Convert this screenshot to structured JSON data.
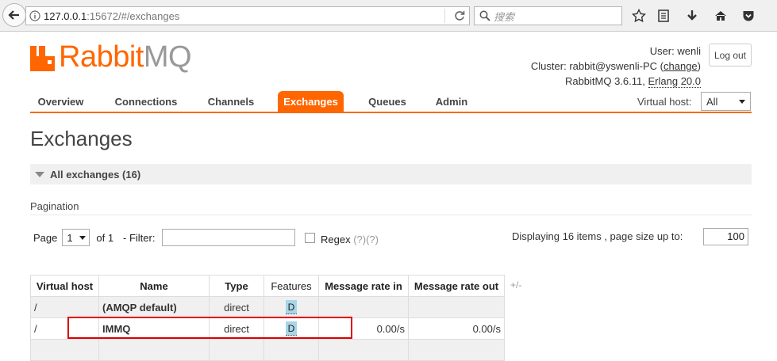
{
  "browser": {
    "url_host": "127.0.0.1",
    "url_rest": ":15672/#/exchanges",
    "search_placeholder": "搜索"
  },
  "logo": {
    "part1": "Rabbit",
    "part2": "MQ"
  },
  "header": {
    "user_label": "User:",
    "user_name": "wenli",
    "cluster_label": "Cluster:",
    "cluster_name": "rabbit@yswenli-PC",
    "cluster_change": "change",
    "version": "RabbitMQ 3.6.11,",
    "erlang": "Erlang 20.0",
    "logout": "Log out"
  },
  "nav": {
    "items": [
      "Overview",
      "Connections",
      "Channels",
      "Exchanges",
      "Queues",
      "Admin"
    ],
    "active": "Exchanges",
    "vhost_label": "Virtual host:",
    "vhost_value": "All"
  },
  "page": {
    "title": "Exchanges",
    "section_title": "All exchanges (16)",
    "pagination_label": "Pagination",
    "page_label": "Page",
    "page_value": "1",
    "of_label": "of 1",
    "filter_label": "- Filter:",
    "regex_label": "Regex",
    "regex_help": "(?)(?)",
    "display_text": "Displaying 16 items , page size up to:",
    "page_size": "100"
  },
  "table": {
    "headers": [
      "Virtual host",
      "Name",
      "Type",
      "Features",
      "Message rate in",
      "Message rate out"
    ],
    "toggle": "+/-",
    "rows": [
      {
        "vhost": "/",
        "name": "(AMQP default)",
        "type": "direct",
        "feature": "D",
        "rate_in": "",
        "rate_out": ""
      },
      {
        "vhost": "/",
        "name": "IMMQ",
        "type": "direct",
        "feature": "D",
        "rate_in": "0.00/s",
        "rate_out": "0.00/s"
      }
    ]
  },
  "colors": {
    "accent": "#ff6600",
    "highlight": "#dd0000",
    "badge": "#a7d6e8"
  }
}
